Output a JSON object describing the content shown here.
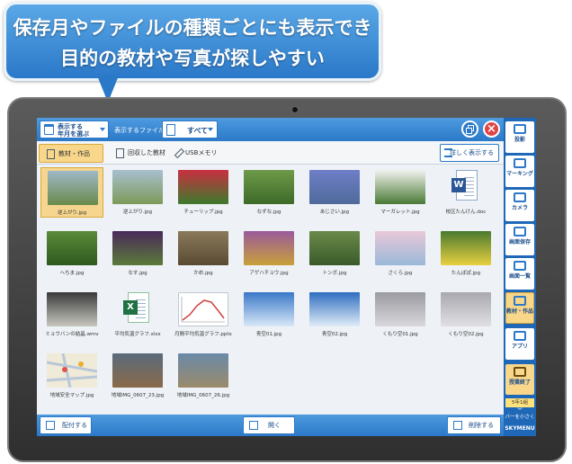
{
  "callout": {
    "line1": "保存月やファイルの種類ごとにも表示でき",
    "line2": "目的の教材や写真が探しやすい"
  },
  "toolbar": {
    "year_button_line1": "表示する",
    "year_button_line2": "年月を選ぶ",
    "file_label": "表示するファイル",
    "file_select_value": "すべて"
  },
  "tabs": [
    {
      "label": "教材・作品"
    },
    {
      "label": "回収した教材"
    },
    {
      "label": "USBメモリ"
    }
  ],
  "detail_button": "詳しく表示する",
  "files": [
    {
      "name": "逆上がり.jpg",
      "kind": "photo",
      "colors": [
        "#9fb8c8",
        "#6a8a4a"
      ],
      "selected": true
    },
    {
      "name": "逆上がり.jpg",
      "kind": "photo",
      "colors": [
        "#a8bfcf",
        "#7d9a58"
      ]
    },
    {
      "name": "チューリップ.jpg",
      "kind": "photo",
      "colors": [
        "#c83040",
        "#3e7a2e"
      ]
    },
    {
      "name": "なずな.jpg",
      "kind": "photo",
      "colors": [
        "#6f9a4a",
        "#3d6a28"
      ]
    },
    {
      "name": "あじさい.jpg",
      "kind": "photo",
      "colors": [
        "#6f7fc8",
        "#4f6a9a"
      ]
    },
    {
      "name": "マーガレット.jpg",
      "kind": "photo",
      "colors": [
        "#f2f2ee",
        "#4a7a36"
      ]
    },
    {
      "name": "校区たんけん.doc",
      "kind": "word"
    },
    {
      "name": "へちま.jpg",
      "kind": "photo",
      "colors": [
        "#5a8a3a",
        "#2e5a1e"
      ]
    },
    {
      "name": "なす.jpg",
      "kind": "photo",
      "colors": [
        "#4a2a5a",
        "#5a7a3a"
      ]
    },
    {
      "name": "かめ.jpg",
      "kind": "photo",
      "colors": [
        "#8a7a5a",
        "#5a4a32"
      ]
    },
    {
      "name": "アゲハチョウ.jpg",
      "kind": "photo",
      "colors": [
        "#9a5a9a",
        "#c8a03a"
      ]
    },
    {
      "name": "トンボ.jpg",
      "kind": "photo",
      "colors": [
        "#6a8a4a",
        "#3a5a2a"
      ]
    },
    {
      "name": "さくら.jpg",
      "kind": "photo",
      "colors": [
        "#e8c8d8",
        "#9ab8d8"
      ]
    },
    {
      "name": "たんぽぽ.jpg",
      "kind": "photo",
      "colors": [
        "#4a7a2e",
        "#e8d040"
      ]
    },
    {
      "name": "ミョウバンの結晶.wmv",
      "kind": "photo",
      "colors": [
        "#3a3a3a",
        "#c8c8c0"
      ]
    },
    {
      "name": "平均気温グラフ.xlsx",
      "kind": "excel"
    },
    {
      "name": "月間平均気温グラフ.pptx",
      "kind": "chart"
    },
    {
      "name": "青空01.jpg",
      "kind": "photo",
      "colors": [
        "#3a78c8",
        "#d8e8f8"
      ]
    },
    {
      "name": "青空02.jpg",
      "kind": "photo",
      "colors": [
        "#2f6ec0",
        "#e0ecf8"
      ]
    },
    {
      "name": "くもり空01.jpg",
      "kind": "photo",
      "colors": [
        "#9a9aa0",
        "#d8d8dc"
      ]
    },
    {
      "name": "くもり空02.jpg",
      "kind": "photo",
      "colors": [
        "#a8a8ae",
        "#e0e0e4"
      ]
    },
    {
      "name": "地域安全マップ.jpg",
      "kind": "map"
    },
    {
      "name": "地域IMG_0607_23.jpg",
      "kind": "photo",
      "colors": [
        "#5a6a7a",
        "#8a6a4a"
      ]
    },
    {
      "name": "地域IMG_0607_26.jpg",
      "kind": "photo",
      "colors": [
        "#6a8aa8",
        "#9a8a6a"
      ]
    }
  ],
  "bottom": {
    "send": "配付する",
    "open": "開く",
    "delete": "削除する"
  },
  "side_menu": [
    {
      "label": "投影",
      "icon": "projector-icon"
    },
    {
      "label": "マーキング",
      "icon": "marker-icon"
    },
    {
      "label": "カメラ",
      "icon": "camera-icon"
    },
    {
      "label": "画面保存",
      "icon": "screen-save-icon"
    },
    {
      "label": "画面一覧",
      "icon": "grid-icon"
    },
    {
      "label": "教材・作品",
      "icon": "folder-icon",
      "active": true
    },
    {
      "label": "アプリ",
      "icon": "app-icon"
    },
    {
      "label": "授業終了",
      "icon": "class-end-icon",
      "end": true
    }
  ],
  "grade_label": "5年1組",
  "smaller_label": "バーを小さく",
  "brand": "SKYMENU"
}
